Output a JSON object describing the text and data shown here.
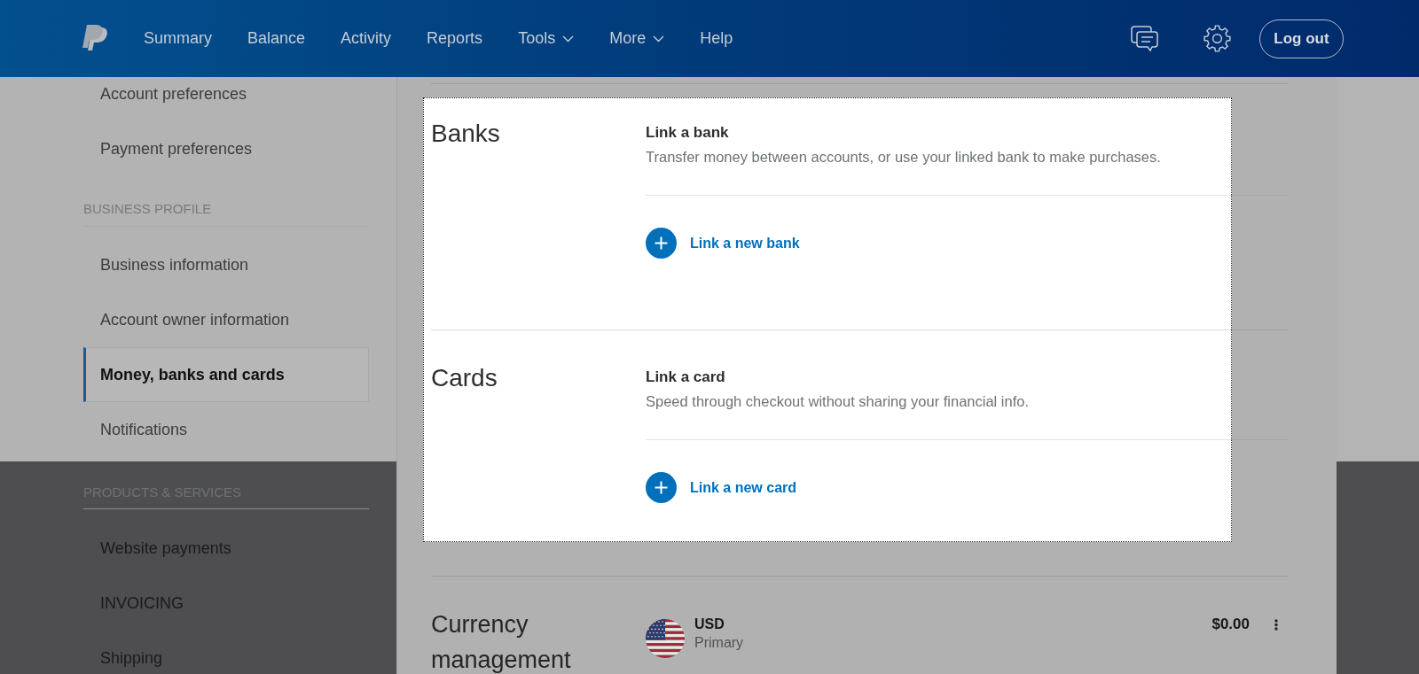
{
  "header": {
    "nav": [
      {
        "label": "Summary",
        "has_menu": false
      },
      {
        "label": "Balance",
        "has_menu": false
      },
      {
        "label": "Activity",
        "has_menu": false
      },
      {
        "label": "Reports",
        "has_menu": false
      },
      {
        "label": "Tools",
        "has_menu": true
      },
      {
        "label": "More",
        "has_menu": true
      },
      {
        "label": "Help",
        "has_menu": false
      }
    ],
    "logout_button": "Log out"
  },
  "sidebar": {
    "groups": [
      {
        "shaded": false,
        "items": [
          {
            "label": "Account preferences",
            "selected": false
          },
          {
            "label": "Payment preferences",
            "selected": false
          }
        ]
      },
      {
        "heading": "BUSINESS PROFILE",
        "shaded": false,
        "items": [
          {
            "label": "Business information",
            "selected": false
          },
          {
            "label": "Account owner information",
            "selected": false
          },
          {
            "label": "Money, banks and cards",
            "selected": true
          },
          {
            "label": "Notifications",
            "selected": false
          }
        ]
      },
      {
        "heading": "PRODUCTS & SERVICES",
        "shaded": true,
        "items": [
          {
            "label": "Website payments",
            "selected": false
          },
          {
            "label": "INVOICING",
            "selected": false
          },
          {
            "label": "Shipping",
            "selected": false
          }
        ]
      }
    ]
  },
  "main": {
    "sections": [
      {
        "kind": "link",
        "title": "Banks",
        "highlighted": true,
        "heading": "Link a bank",
        "description": "Transfer money between accounts, or use your linked bank to make purchases.",
        "action": "Link a new bank"
      },
      {
        "kind": "link",
        "title": "Cards",
        "highlighted": true,
        "heading": "Link a card",
        "description": "Speed through checkout without sharing your financial info.",
        "action": "Link a new card"
      },
      {
        "kind": "currency",
        "title": "Currency management",
        "highlighted": false,
        "currencies": [
          {
            "code": "USD",
            "label": "Primary",
            "balance": "$0.00"
          }
        ]
      }
    ]
  }
}
